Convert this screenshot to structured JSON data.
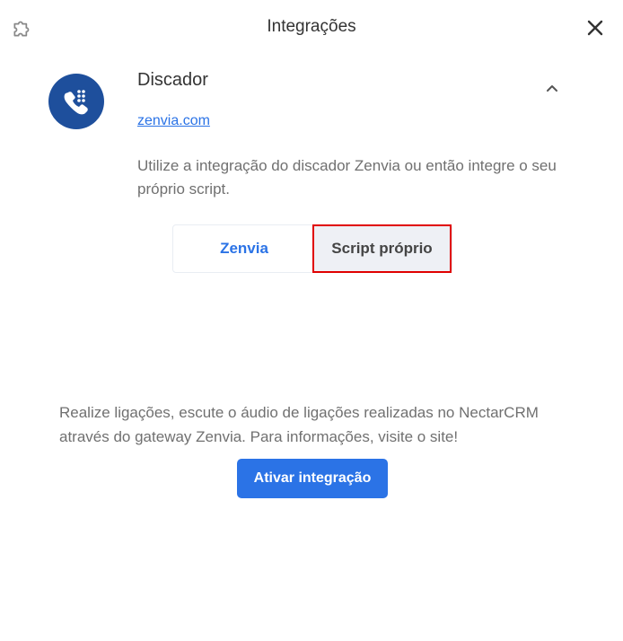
{
  "header": {
    "title": "Integrações"
  },
  "integration": {
    "name": "Discador",
    "link": "zenvia.com",
    "description": "Utilize a integração do discador Zenvia ou então integre o seu próprio script.",
    "options": [
      "Zenvia",
      "Script próprio"
    ],
    "info": "Realize ligações, escute o áudio de ligações realizadas no NectarCRM através do gateway Zenvia. Para informações, visite o site!",
    "activate_label": "Ativar integração"
  },
  "colors": {
    "accent": "#2b73e6",
    "logo_bg": "#1e4f9c",
    "highlight": "#e00000"
  }
}
